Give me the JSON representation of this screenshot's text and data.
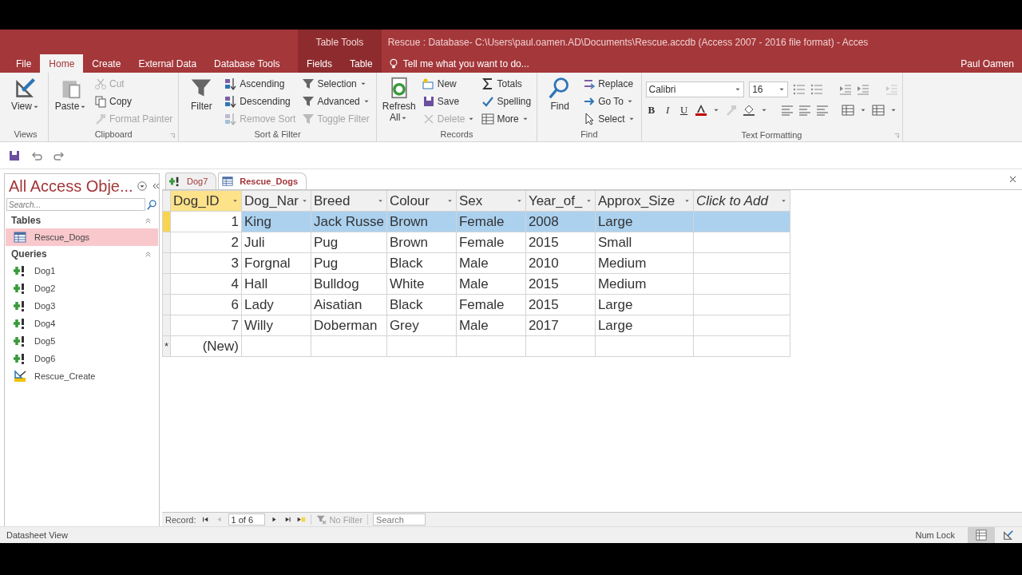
{
  "title_bar": {
    "contextual_label": "Table Tools",
    "title": "Rescue : Database- C:\\Users\\paul.oamen.AD\\Documents\\Rescue.accdb (Access 2007 - 2016 file format) - Acces"
  },
  "ribbon_tabs": [
    {
      "label": "File",
      "selected": false,
      "contextual": false
    },
    {
      "label": "Home",
      "selected": true,
      "contextual": false
    },
    {
      "label": "Create",
      "selected": false,
      "contextual": false
    },
    {
      "label": "External Data",
      "selected": false,
      "contextual": false
    },
    {
      "label": "Database Tools",
      "selected": false,
      "contextual": false
    },
    {
      "label": "Fields",
      "selected": false,
      "contextual": true
    },
    {
      "label": "Table",
      "selected": false,
      "contextual": true
    }
  ],
  "tell_me": {
    "placeholder": "Tell me what you want to do..."
  },
  "user": "Paul Oamen",
  "ribbon_groups": [
    {
      "label": "Views",
      "launcher": false,
      "items": [
        {
          "kind": "large",
          "label": "View",
          "dropdown": true,
          "disabled": false
        }
      ]
    },
    {
      "label": "Clipboard",
      "launcher": true,
      "items": [
        {
          "kind": "large",
          "label": "Paste",
          "dropdown": true,
          "disabled": false
        },
        {
          "kind": "small",
          "label": "Cut",
          "dropdown": false,
          "disabled": true
        },
        {
          "kind": "small",
          "label": "Copy",
          "dropdown": false,
          "disabled": false
        },
        {
          "kind": "small",
          "label": "Format Painter",
          "dropdown": false,
          "disabled": true
        }
      ]
    },
    {
      "label": "Sort & Filter",
      "launcher": false,
      "items": [
        {
          "kind": "large",
          "label": "Filter",
          "dropdown": false,
          "disabled": false
        },
        {
          "kind": "small",
          "label": "Ascending",
          "dropdown": false,
          "disabled": false
        },
        {
          "kind": "small",
          "label": "Descending",
          "dropdown": false,
          "disabled": false
        },
        {
          "kind": "small",
          "label": "Remove Sort",
          "dropdown": false,
          "disabled": true
        },
        {
          "kind": "small",
          "label": "Selection",
          "dropdown": true,
          "disabled": false
        },
        {
          "kind": "small",
          "label": "Advanced",
          "dropdown": true,
          "disabled": false
        },
        {
          "kind": "small",
          "label": "Toggle Filter",
          "dropdown": false,
          "disabled": true
        }
      ]
    },
    {
      "label": "Records",
      "launcher": false,
      "items": [
        {
          "kind": "large",
          "label": "Refresh All",
          "dropdown": true,
          "disabled": false
        },
        {
          "kind": "small",
          "label": "New",
          "dropdown": false,
          "disabled": false
        },
        {
          "kind": "small",
          "label": "Save",
          "dropdown": false,
          "disabled": false
        },
        {
          "kind": "small",
          "label": "Delete",
          "dropdown": true,
          "disabled": true
        },
        {
          "kind": "small",
          "label": "Totals",
          "dropdown": false,
          "disabled": false
        },
        {
          "kind": "small",
          "label": "Spelling",
          "dropdown": false,
          "disabled": false
        },
        {
          "kind": "small",
          "label": "More",
          "dropdown": true,
          "disabled": false
        }
      ]
    },
    {
      "label": "Find",
      "launcher": false,
      "items": [
        {
          "kind": "large",
          "label": "Find",
          "dropdown": false,
          "disabled": false
        },
        {
          "kind": "small",
          "label": "Replace",
          "dropdown": false,
          "disabled": false
        },
        {
          "kind": "small",
          "label": "Go To",
          "dropdown": true,
          "disabled": false
        },
        {
          "kind": "small",
          "label": "Select",
          "dropdown": true,
          "disabled": false
        }
      ]
    }
  ],
  "text_formatting": {
    "label": "Text Formatting",
    "launcher": true,
    "font": "Calibri",
    "size": "16",
    "styles": [
      "B",
      "I",
      "U"
    ]
  },
  "navigation": {
    "title": "All Access Obje...",
    "search": {
      "placeholder": "Search..."
    },
    "groups": [
      {
        "label": "Tables",
        "expanded": true,
        "items": [
          {
            "kind": "table",
            "label": "Rescue_Dogs",
            "selected": true
          }
        ]
      },
      {
        "label": "Queries",
        "expanded": true,
        "items": [
          {
            "kind": "query",
            "label": "Dog1",
            "selected": false
          },
          {
            "kind": "query",
            "label": "Dog2",
            "selected": false
          },
          {
            "kind": "query",
            "label": "Dog3",
            "selected": false
          },
          {
            "kind": "query",
            "label": "Dog4",
            "selected": false
          },
          {
            "kind": "query",
            "label": "Dog5",
            "selected": false
          },
          {
            "kind": "query",
            "label": "Dog6",
            "selected": false
          },
          {
            "kind": "make_table",
            "label": "Rescue_Create",
            "selected": false
          }
        ]
      }
    ]
  },
  "doc_tabs": [
    {
      "kind": "query",
      "label": "Dog7",
      "selected": false
    },
    {
      "kind": "table",
      "label": "Rescue_Dogs",
      "selected": true
    }
  ],
  "datasheet": {
    "columns": [
      {
        "kind": "number",
        "label": "Dog_ID",
        "active": true
      },
      {
        "kind": "text",
        "label": "Dog_Nar",
        "active": false
      },
      {
        "kind": "text",
        "label": "Breed",
        "active": false
      },
      {
        "kind": "text",
        "label": "Colour",
        "active": false
      },
      {
        "kind": "text",
        "label": "Sex",
        "active": false
      },
      {
        "kind": "text",
        "label": "Year_of_",
        "active": false
      },
      {
        "kind": "text",
        "label": "Approx_Size",
        "active": false
      },
      {
        "kind": "add",
        "label": "Click to Add",
        "active": false
      }
    ],
    "rows": [
      {
        "selected": true,
        "cells": [
          "1",
          "King",
          "Jack Russe",
          "Brown",
          "Female",
          "2008",
          "Large"
        ]
      },
      {
        "selected": false,
        "cells": [
          "2",
          "Juli",
          "Pug",
          "Brown",
          "Female",
          "2015",
          "Small"
        ]
      },
      {
        "selected": false,
        "cells": [
          "3",
          "Forgnal",
          "Pug",
          "Black",
          "Male",
          "2010",
          "Medium"
        ]
      },
      {
        "selected": false,
        "cells": [
          "4",
          "Hall",
          "Bulldog",
          "White",
          "Male",
          "2015",
          "Medium"
        ]
      },
      {
        "selected": false,
        "cells": [
          "6",
          "Lady",
          "Aisatian",
          "Black",
          "Female",
          "2015",
          "Large"
        ]
      },
      {
        "selected": false,
        "cells": [
          "7",
          "Willy",
          "Doberman",
          "Grey",
          "Male",
          "2017",
          "Large"
        ]
      }
    ],
    "new_row": {
      "marker": "*",
      "label": "(New)"
    }
  },
  "record_nav": {
    "label": "Record:",
    "position": "1 of 6",
    "filter": "No Filter",
    "search": {
      "placeholder": "Search"
    }
  },
  "status_bar": {
    "view": "Datasheet View",
    "num_lock": "Num Lock",
    "views": [
      {
        "kind": "datasheet",
        "selected": true
      },
      {
        "kind": "design",
        "selected": false
      }
    ]
  }
}
